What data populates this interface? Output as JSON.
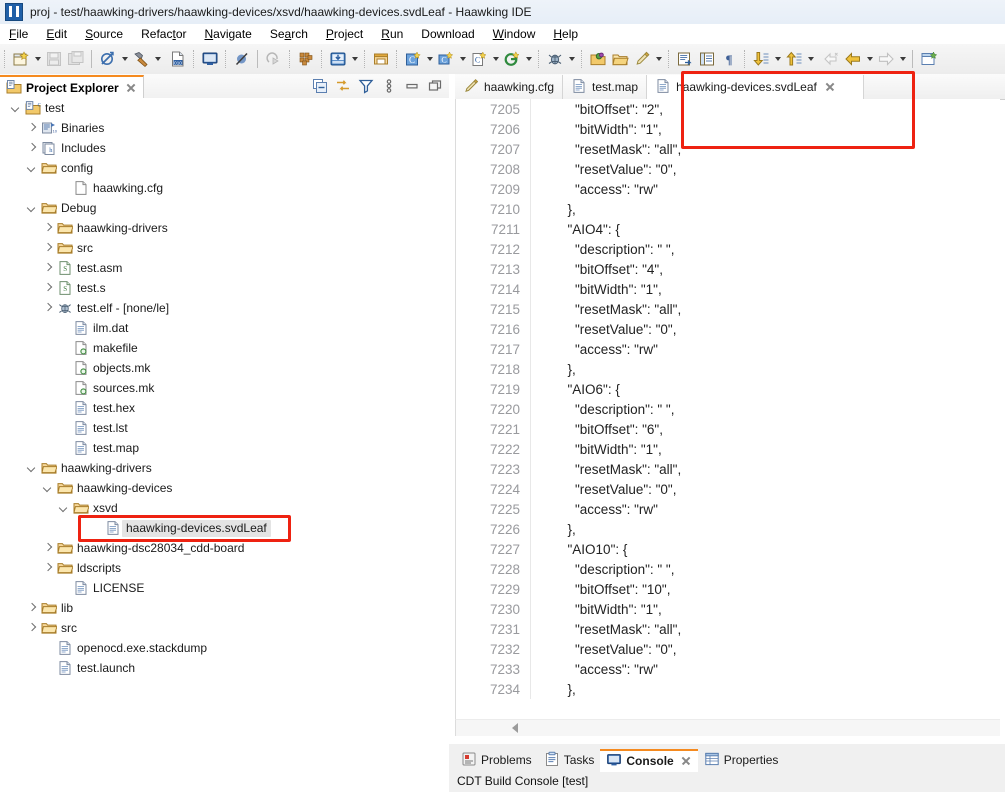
{
  "window": {
    "title": "proj - test/haawking-drivers/haawking-devices/xsvd/haawking-devices.svdLeaf - Haawking IDE",
    "app_icon": "ide-logo-icon"
  },
  "menubar": {
    "items": [
      {
        "label": "File"
      },
      {
        "label": "Edit"
      },
      {
        "label": "Source"
      },
      {
        "label": "Refactor"
      },
      {
        "label": "Navigate"
      },
      {
        "label": "Search"
      },
      {
        "label": "Project"
      },
      {
        "label": "Run"
      },
      {
        "label": "Download"
      },
      {
        "label": "Window"
      },
      {
        "label": "Help"
      }
    ]
  },
  "toolbar": {
    "groups": [
      {
        "items": [
          {
            "name": "new-wizard-icon",
            "arrow": true
          },
          {
            "name": "save-icon",
            "arrow": false
          },
          {
            "name": "save-all-icon",
            "arrow": false
          }
        ]
      },
      {
        "items": [
          {
            "name": "clean-build-icon",
            "arrow": true
          },
          {
            "name": "build-hammer-icon",
            "arrow": true
          }
        ]
      },
      {
        "items": [
          {
            "name": "binary-file-icon",
            "arrow": false
          },
          {
            "name": "terminal-icon",
            "arrow": false
          },
          {
            "name": "skip-breakpoints-icon",
            "arrow": false
          }
        ]
      },
      {
        "items": [
          {
            "name": "resume-icon",
            "arrow": false
          },
          {
            "name": "memory-icon",
            "arrow": false
          },
          {
            "name": "download-flash-icon",
            "arrow": true
          },
          {
            "name": "restore-window-icon",
            "arrow": false
          },
          {
            "name": "new-c-project-icon",
            "arrow": true
          },
          {
            "name": "new-c-folder-icon",
            "arrow": true
          },
          {
            "name": "new-c-file-icon",
            "arrow": true
          },
          {
            "name": "new-class-icon",
            "arrow": true
          }
        ]
      },
      {
        "items": [
          {
            "name": "debug-bug-icon",
            "arrow": true
          },
          {
            "name": "run-external-icon",
            "arrow": false
          },
          {
            "name": "open-folder-icon",
            "arrow": false
          },
          {
            "name": "pencil-edit-icon",
            "arrow": true
          }
        ]
      },
      {
        "items": [
          {
            "name": "open-declaration-icon",
            "arrow": false
          },
          {
            "name": "outline-toggle-icon",
            "arrow": false
          },
          {
            "name": "pilcrow-icon",
            "arrow": false
          }
        ]
      },
      {
        "items": [
          {
            "name": "next-annotation-icon",
            "arrow": true
          },
          {
            "name": "previous-annotation-icon",
            "arrow": true
          },
          {
            "name": "back-history-disabled-icon",
            "arrow": false
          },
          {
            "name": "back-icon",
            "arrow": true
          },
          {
            "name": "forward-icon",
            "arrow": true
          }
        ]
      },
      {
        "items": [
          {
            "name": "new-window-icon",
            "arrow": false
          }
        ]
      }
    ]
  },
  "explorer": {
    "tab_label": "Project Explorer",
    "tab_icon": "project-explorer-icon",
    "view_tools": [
      {
        "name": "collapse-all-icon"
      },
      {
        "name": "link-with-editor-icon"
      },
      {
        "name": "filter-icon"
      },
      {
        "name": "view-menu-icon"
      },
      {
        "name": "minimize-icon"
      },
      {
        "name": "maximize-icon"
      }
    ],
    "tree": [
      {
        "label": "test",
        "indent": 0,
        "icon": "c-project-icon",
        "twisty": "open"
      },
      {
        "label": "Binaries",
        "indent": 1,
        "icon": "binaries-icon",
        "twisty": "closed"
      },
      {
        "label": "Includes",
        "indent": 1,
        "icon": "includes-icon",
        "twisty": "closed"
      },
      {
        "label": "config",
        "indent": 1,
        "icon": "folder-icon",
        "twisty": "open"
      },
      {
        "label": "haawking.cfg",
        "indent": 3,
        "icon": "blank-file-icon",
        "twisty": "none"
      },
      {
        "label": "Debug",
        "indent": 1,
        "icon": "folder-icon",
        "twisty": "open"
      },
      {
        "label": "haawking-drivers",
        "indent": 2,
        "icon": "folder-icon",
        "twisty": "closed"
      },
      {
        "label": "src",
        "indent": 2,
        "icon": "folder-icon",
        "twisty": "closed"
      },
      {
        "label": "test.asm",
        "indent": 2,
        "icon": "asm-file-icon",
        "twisty": "closed"
      },
      {
        "label": "test.s",
        "indent": 2,
        "icon": "asm-file-icon",
        "twisty": "closed"
      },
      {
        "label": "test.elf - [none/le]",
        "indent": 2,
        "icon": "elf-binary-icon",
        "twisty": "closed"
      },
      {
        "label": "ilm.dat",
        "indent": 3,
        "icon": "text-file-icon",
        "twisty": "none"
      },
      {
        "label": "makefile",
        "indent": 3,
        "icon": "makefile-icon",
        "twisty": "none"
      },
      {
        "label": "objects.mk",
        "indent": 3,
        "icon": "makefile-icon",
        "twisty": "none"
      },
      {
        "label": "sources.mk",
        "indent": 3,
        "icon": "makefile-icon",
        "twisty": "none"
      },
      {
        "label": "test.hex",
        "indent": 3,
        "icon": "text-file-icon",
        "twisty": "none"
      },
      {
        "label": "test.lst",
        "indent": 3,
        "icon": "text-file-icon",
        "twisty": "none"
      },
      {
        "label": "test.map",
        "indent": 3,
        "icon": "text-file-icon",
        "twisty": "none"
      },
      {
        "label": "haawking-drivers",
        "indent": 1,
        "icon": "folder-icon",
        "twisty": "open"
      },
      {
        "label": "haawking-devices",
        "indent": 2,
        "icon": "folder-icon",
        "twisty": "open"
      },
      {
        "label": "xsvd",
        "indent": 3,
        "icon": "folder-icon",
        "twisty": "open"
      },
      {
        "label": "haawking-devices.svdLeaf",
        "indent": 5,
        "icon": "text-file-icon",
        "twisty": "none",
        "selected": true
      },
      {
        "label": "haawking-dsc28034_cdd-board",
        "indent": 2,
        "icon": "folder-icon",
        "twisty": "closed"
      },
      {
        "label": "ldscripts",
        "indent": 2,
        "icon": "folder-icon",
        "twisty": "closed"
      },
      {
        "label": "LICENSE",
        "indent": 3,
        "icon": "text-file-icon",
        "twisty": "none"
      },
      {
        "label": "lib",
        "indent": 1,
        "icon": "folder-icon",
        "twisty": "closed"
      },
      {
        "label": "src",
        "indent": 1,
        "icon": "folder-icon",
        "twisty": "closed"
      },
      {
        "label": "openocd.exe.stackdump",
        "indent": 2,
        "icon": "text-file-icon",
        "twisty": "none"
      },
      {
        "label": "test.launch",
        "indent": 2,
        "icon": "text-file-icon",
        "twisty": "none"
      }
    ]
  },
  "editor": {
    "tabs": [
      {
        "label": "haawking.cfg",
        "icon": "cfg-file-icon",
        "active": false,
        "closable": false
      },
      {
        "label": "test.map",
        "icon": "text-file-icon",
        "active": false,
        "closable": false
      },
      {
        "label": "haawking-devices.svdLeaf",
        "icon": "text-file-icon",
        "active": true,
        "closable": true
      }
    ],
    "lines": [
      {
        "no": "7205",
        "text": "        \"bitOffset\": \"2\","
      },
      {
        "no": "7206",
        "text": "        \"bitWidth\": \"1\","
      },
      {
        "no": "7207",
        "text": "        \"resetMask\": \"all\","
      },
      {
        "no": "7208",
        "text": "        \"resetValue\": \"0\","
      },
      {
        "no": "7209",
        "text": "        \"access\": \"rw\""
      },
      {
        "no": "7210",
        "text": "      },"
      },
      {
        "no": "7211",
        "text": "      \"AIO4\": {"
      },
      {
        "no": "7212",
        "text": "        \"description\": \" \","
      },
      {
        "no": "7213",
        "text": "        \"bitOffset\": \"4\","
      },
      {
        "no": "7214",
        "text": "        \"bitWidth\": \"1\","
      },
      {
        "no": "7215",
        "text": "        \"resetMask\": \"all\","
      },
      {
        "no": "7216",
        "text": "        \"resetValue\": \"0\","
      },
      {
        "no": "7217",
        "text": "        \"access\": \"rw\""
      },
      {
        "no": "7218",
        "text": "      },"
      },
      {
        "no": "7219",
        "text": "      \"AIO6\": {"
      },
      {
        "no": "7220",
        "text": "        \"description\": \" \","
      },
      {
        "no": "7221",
        "text": "        \"bitOffset\": \"6\","
      },
      {
        "no": "7222",
        "text": "        \"bitWidth\": \"1\","
      },
      {
        "no": "7223",
        "text": "        \"resetMask\": \"all\","
      },
      {
        "no": "7224",
        "text": "        \"resetValue\": \"0\","
      },
      {
        "no": "7225",
        "text": "        \"access\": \"rw\""
      },
      {
        "no": "7226",
        "text": "      },"
      },
      {
        "no": "7227",
        "text": "      \"AIO10\": {"
      },
      {
        "no": "7228",
        "text": "        \"description\": \" \","
      },
      {
        "no": "7229",
        "text": "        \"bitOffset\": \"10\","
      },
      {
        "no": "7230",
        "text": "        \"bitWidth\": \"1\","
      },
      {
        "no": "7231",
        "text": "        \"resetMask\": \"all\","
      },
      {
        "no": "7232",
        "text": "        \"resetValue\": \"0\","
      },
      {
        "no": "7233",
        "text": "        \"access\": \"rw\""
      },
      {
        "no": "7234",
        "text": "      },"
      }
    ]
  },
  "bottom_panel": {
    "tabs": [
      {
        "label": "Problems",
        "icon": "problems-icon",
        "active": false,
        "closable": false
      },
      {
        "label": "Tasks",
        "icon": "tasks-icon",
        "active": false,
        "closable": false
      },
      {
        "label": "Console",
        "icon": "console-icon",
        "active": true,
        "closable": true
      },
      {
        "label": "Properties",
        "icon": "properties-icon",
        "active": false,
        "closable": false
      }
    ],
    "console_title": "CDT Build Console [test]"
  },
  "annotations": {
    "highlight_color": "#ee2211",
    "boxes": [
      {
        "name": "editor-tab-highlight"
      },
      {
        "name": "tree-file-highlight"
      }
    ]
  }
}
